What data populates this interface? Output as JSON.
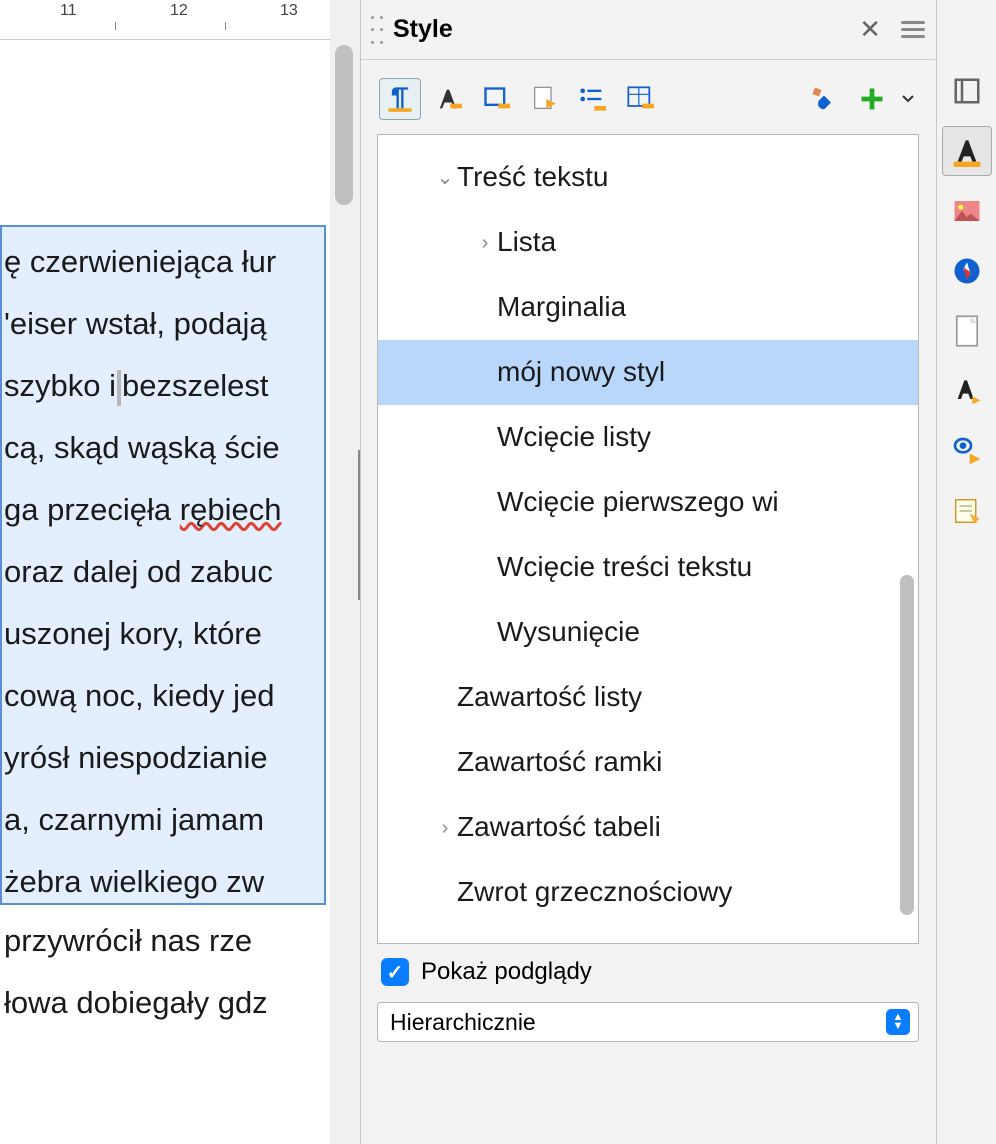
{
  "ruler": {
    "marks": [
      "11",
      "12",
      "13"
    ]
  },
  "document": {
    "selected_lines": [
      "ę czerwieniejąca łur",
      "'eiser wstał, podają",
      "szybko i bezszelest",
      "cą, skąd wąską ście",
      "ga przecięła rębiech",
      "oraz dalej od zabuc",
      "uszonej kory, które",
      "cową noc, kiedy jed",
      "yrósł niespodzianie",
      "a, czarnymi jamam",
      "żebra wielkiego zw"
    ],
    "below_lines": [
      " przywrócił nas rze",
      "łowa dobiegały gdz"
    ],
    "spellcheck_word_index": 4
  },
  "panel": {
    "title": "Style",
    "toolbar_icons": [
      "paragraph-style-icon",
      "character-style-icon",
      "frame-style-icon",
      "page-style-icon",
      "list-style-icon",
      "table-style-icon"
    ],
    "right_toolbar_icons": [
      "fill-format-icon",
      "new-style-icon"
    ],
    "tree": [
      {
        "label": "Treść tekstu",
        "level": 0,
        "expand": "open"
      },
      {
        "label": "Lista",
        "level": 1,
        "expand": "closed"
      },
      {
        "label": "Marginalia",
        "level": 1
      },
      {
        "label": "mój nowy styl",
        "level": 1,
        "selected": true
      },
      {
        "label": "Wcięcie listy",
        "level": 1
      },
      {
        "label": "Wcięcie pierwszego wi",
        "level": 1
      },
      {
        "label": "Wcięcie treści tekstu",
        "level": 1
      },
      {
        "label": "Wysunięcie",
        "level": 1
      },
      {
        "label": "Zawartość listy",
        "level": 0
      },
      {
        "label": "Zawartość ramki",
        "level": 0
      },
      {
        "label": "Zawartość tabeli",
        "level": 0,
        "expand": "closed"
      },
      {
        "label": "Zwrot grzecznościowy",
        "level": 0
      }
    ],
    "preview_checkbox": {
      "label": "Pokaż podglądy",
      "checked": true
    },
    "view_mode": "Hierarchicznie"
  },
  "right_strip_icons": [
    "properties-icon",
    "styles-icon",
    "gallery-icon",
    "navigator-icon",
    "page-icon",
    "style-inspector-icon",
    "accessibility-check-icon",
    "manage-changes-icon"
  ]
}
